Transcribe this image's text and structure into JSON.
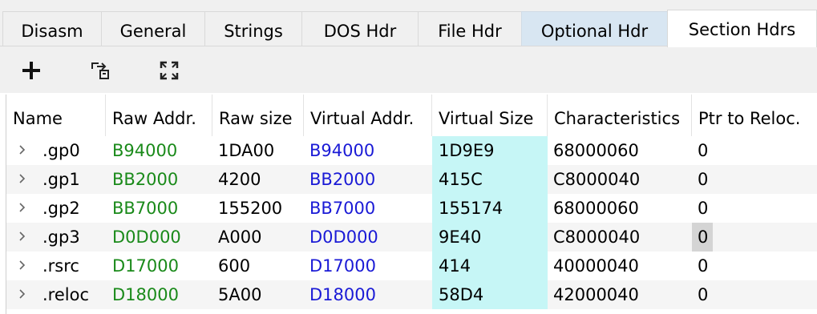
{
  "tabs": [
    {
      "label": "Disasm"
    },
    {
      "label": "General"
    },
    {
      "label": "Strings"
    },
    {
      "label": "DOS Hdr"
    },
    {
      "label": "File Hdr"
    },
    {
      "label": "Optional Hdr"
    },
    {
      "label": "Section Hdrs"
    }
  ],
  "toolbar": {
    "add_icon": "plus-icon",
    "export_icon": "export-icon",
    "expand_icon": "expand-icon"
  },
  "table": {
    "columns": [
      "Name",
      "Raw Addr.",
      "Raw size",
      "Virtual Addr.",
      "Virtual Size",
      "Characteristics",
      "Ptr to Reloc."
    ],
    "rows": [
      {
        "name": ".gp0",
        "raw_addr": "B94000",
        "raw_size": "1DA00",
        "virt_addr": "B94000",
        "virt_size": "1D9E9",
        "characteristics": "68000060",
        "ptr_reloc": "0"
      },
      {
        "name": ".gp1",
        "raw_addr": "BB2000",
        "raw_size": "4200",
        "virt_addr": "BB2000",
        "virt_size": "415C",
        "characteristics": "C8000040",
        "ptr_reloc": "0"
      },
      {
        "name": ".gp2",
        "raw_addr": "BB7000",
        "raw_size": "155200",
        "virt_addr": "BB7000",
        "virt_size": "155174",
        "characteristics": "68000060",
        "ptr_reloc": "0"
      },
      {
        "name": ".gp3",
        "raw_addr": "D0D000",
        "raw_size": "A000",
        "virt_addr": "D0D000",
        "virt_size": "9E40",
        "characteristics": "C8000040",
        "ptr_reloc": "0"
      },
      {
        "name": ".rsrc",
        "raw_addr": "D17000",
        "raw_size": "600",
        "virt_addr": "D17000",
        "virt_size": "414",
        "characteristics": "40000040",
        "ptr_reloc": "0"
      },
      {
        "name": ".reloc",
        "raw_addr": "D18000",
        "raw_size": "5A00",
        "virt_addr": "D18000",
        "virt_size": "58D4",
        "characteristics": "42000040",
        "ptr_reloc": "0"
      }
    ]
  },
  "colors": {
    "raw_addr": "#1a8a1a",
    "virt_addr": "#1a1ad6",
    "virt_size_bg": "#c6f6f6",
    "tab_hover": "#d8e6f2"
  }
}
